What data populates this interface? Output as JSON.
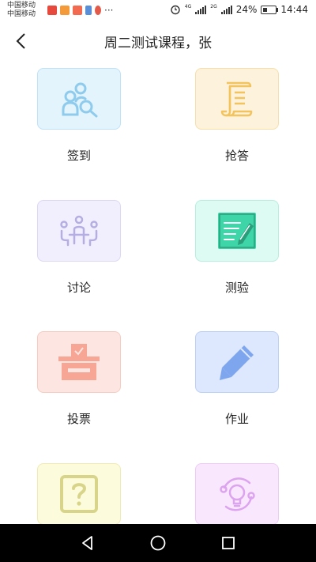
{
  "status_bar": {
    "carrier_1": "中国移动",
    "carrier_2": "中国移动",
    "dots": "···",
    "net_1": "4G",
    "net_2": "2G",
    "battery": "24%",
    "time": "14:44"
  },
  "header": {
    "title": "周二测试课程，张"
  },
  "tiles": [
    {
      "label": "签到",
      "icon": "sign-in-people-search-icon",
      "bg": "#e3f4fd",
      "border": "#bfe2f7",
      "color": "#8fcbec"
    },
    {
      "label": "抢答",
      "icon": "scroll-icon",
      "bg": "#fdf2dc",
      "border": "#f6dfaa",
      "color": "#f3c35e"
    },
    {
      "label": "讨论",
      "icon": "discussion-people-icon",
      "bg": "#f1effd",
      "border": "#dcd8f3",
      "color": "#b5aee3"
    },
    {
      "label": "测验",
      "icon": "quiz-edit-icon",
      "bg": "#ddfbf3",
      "border": "#b6eedf",
      "color": "#3ed6a9"
    },
    {
      "label": "投票",
      "icon": "ballot-box-icon",
      "bg": "#fde6e1",
      "border": "#f7cbc2",
      "color": "#f7a595"
    },
    {
      "label": "作业",
      "icon": "pencil-icon",
      "bg": "#dde7fd",
      "border": "#bcd0f7",
      "color": "#7ea6ef"
    },
    {
      "label": "",
      "icon": "question-icon",
      "bg": "#fcfbdc",
      "border": "#efeab3",
      "color": "#d8d58a"
    },
    {
      "label": "",
      "icon": "lightbulb-orbit-icon",
      "bg": "#f9e8fd",
      "border": "#ecccf5",
      "color": "#dca3ef"
    }
  ]
}
